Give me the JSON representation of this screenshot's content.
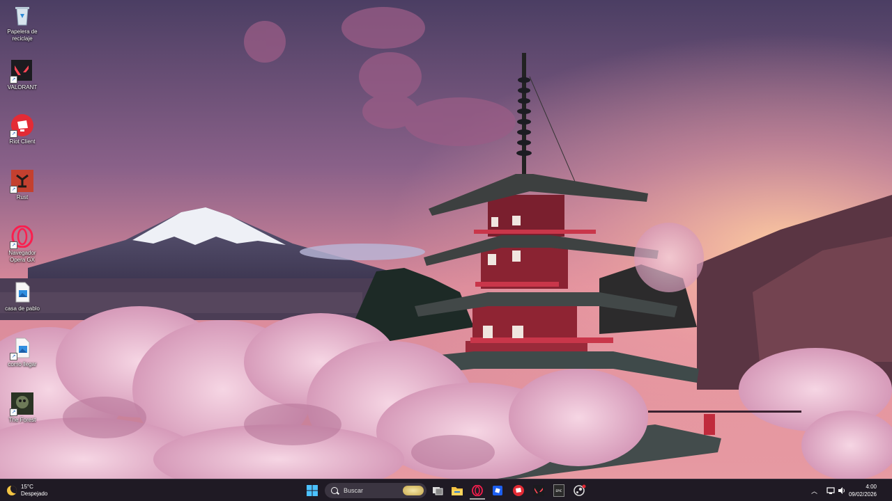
{
  "desktop": {
    "icons": [
      {
        "label": "Papelera de reciclaje",
        "icon": "recycle-bin-icon"
      },
      {
        "label": "VALORANT",
        "icon": "valorant-icon"
      },
      {
        "label": "Riot Client",
        "icon": "riot-client-icon"
      },
      {
        "label": "Rust",
        "icon": "rust-icon"
      },
      {
        "label": "Navegador Opera GX",
        "icon": "opera-gx-icon"
      },
      {
        "label": "casa de pablo",
        "icon": "image-file-icon"
      },
      {
        "label": "como llegar",
        "icon": "image-file-icon"
      },
      {
        "label": "The Forest",
        "icon": "the-forest-icon"
      }
    ]
  },
  "taskbar": {
    "weather": {
      "temp": "15°C",
      "condition": "Despejado",
      "icon": "moon-icon"
    },
    "search": {
      "placeholder": "Buscar"
    },
    "apps": [
      "start-icon",
      "task-view-icon",
      "file-explorer-icon",
      "opera-gx-icon",
      "roblox-icon",
      "riot-client-icon",
      "valorant-icon",
      "epic-games-icon",
      "steam-icon"
    ],
    "epic_label": "EPIC",
    "clock": {
      "time": "4:00",
      "date": "09/02/2026"
    }
  },
  "colors": {
    "taskbar": "#1f1a24",
    "accent": "#e32b4a"
  }
}
